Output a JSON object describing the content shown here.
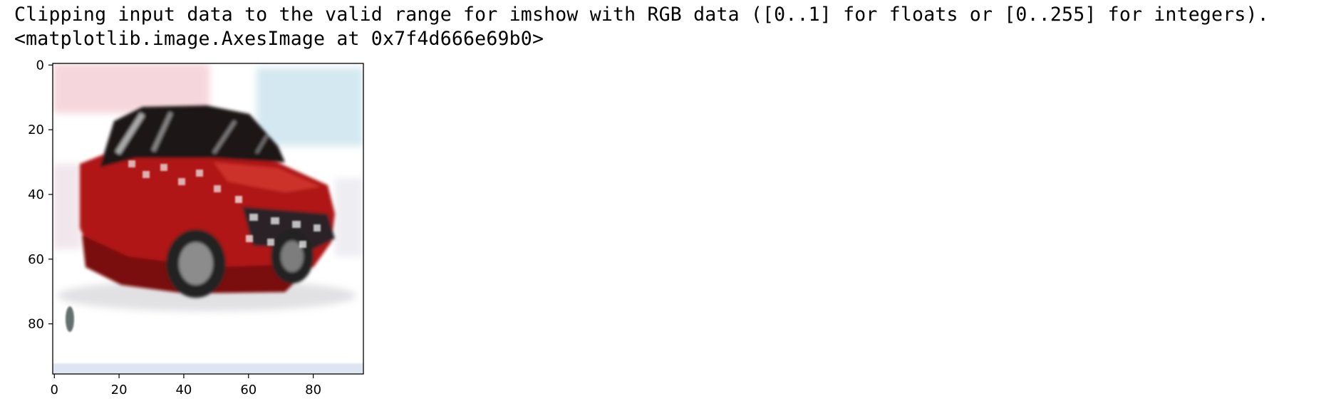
{
  "output": {
    "warning_line": "Clipping input data to the valid range for imshow with RGB data ([0..1] for floats or [0..255] for integers).",
    "repr_line": "<matplotlib.image.AxesImage at 0x7f4d666e69b0>"
  },
  "chart_data": {
    "type": "image",
    "image_content": "blurry generated image of a red car on a white background",
    "x_ticks": [
      "0",
      "20",
      "40",
      "60",
      "80"
    ],
    "y_ticks": [
      "0",
      "20",
      "40",
      "60",
      "80"
    ],
    "xlim": [
      -0.5,
      95.5
    ],
    "ylim": [
      95.5,
      -0.5
    ],
    "title": "",
    "xlabel": "",
    "ylabel": ""
  },
  "colors": {
    "car_body": "#b01818",
    "car_dark": "#5a0a0a",
    "window": "#1a1418",
    "tire": "#222222",
    "sky_tint": "#cfe6ef",
    "pink_tint": "#f2c6cf",
    "axes": "#000000"
  }
}
